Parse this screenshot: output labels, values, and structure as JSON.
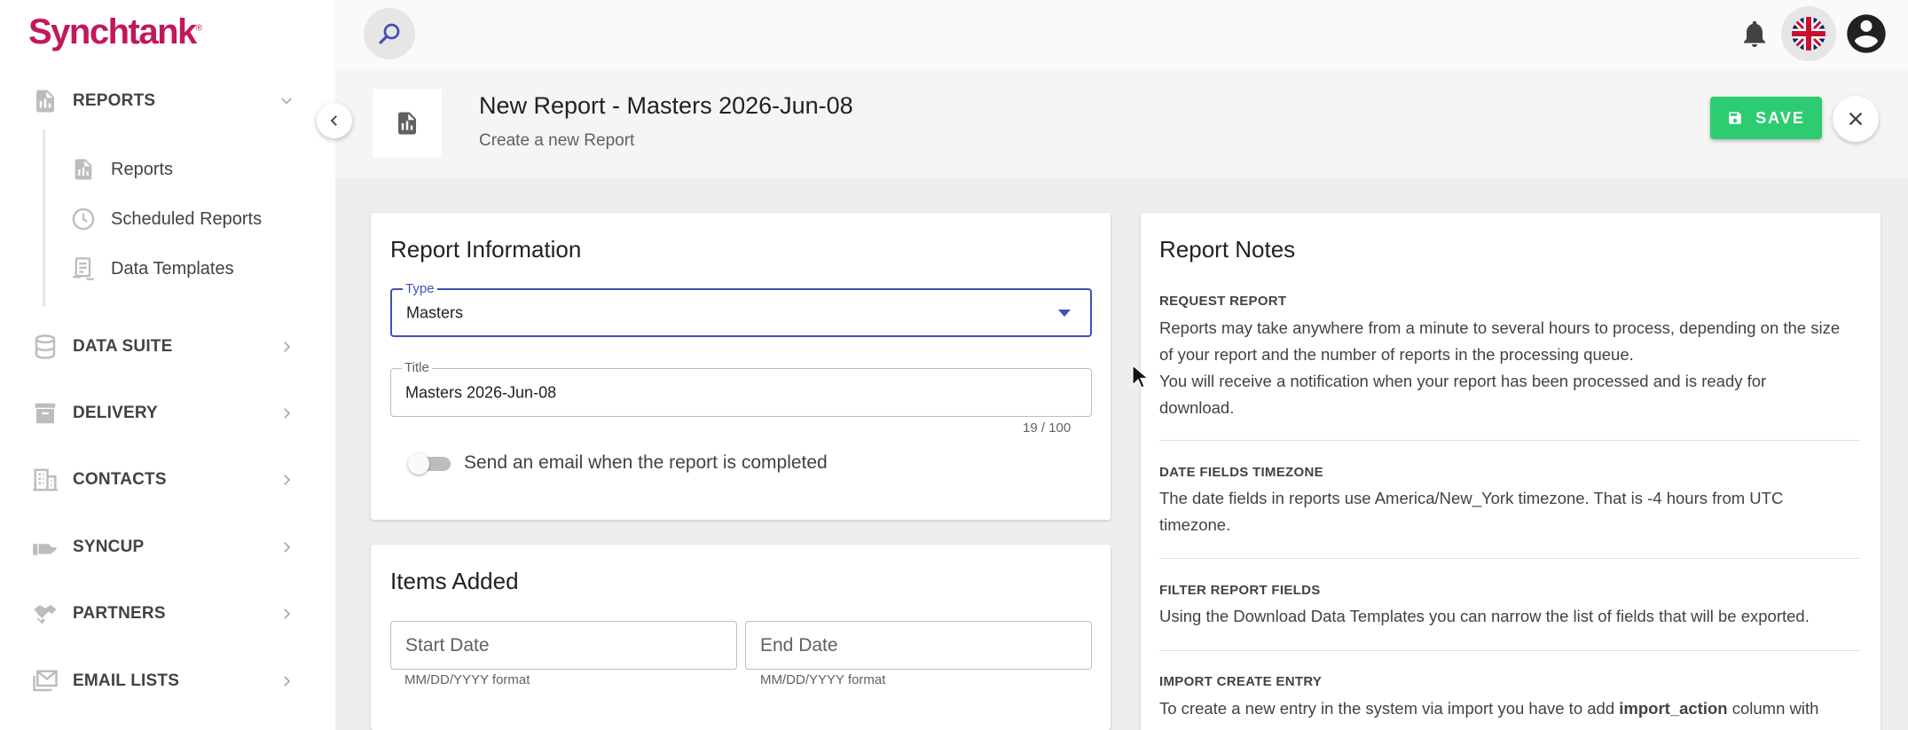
{
  "brand": {
    "logo_text": "Synchtank",
    "logo_mark": "®",
    "color": "#c2185b"
  },
  "sidebar": {
    "groups": [
      {
        "label": "REPORTS",
        "icon": "report-file-icon",
        "expanded": true
      },
      {
        "label": "DATA SUITE",
        "icon": "database-icon"
      },
      {
        "label": "DELIVERY",
        "icon": "archive-box-icon"
      },
      {
        "label": "CONTACTS",
        "icon": "building-icon"
      },
      {
        "label": "SYNCUP",
        "icon": "hand-icon"
      },
      {
        "label": "PARTNERS",
        "icon": "handshake-icon"
      },
      {
        "label": "EMAIL LISTS",
        "icon": "mail-list-icon"
      }
    ],
    "report_items": [
      {
        "label": "Reports",
        "icon": "report-file-icon"
      },
      {
        "label": "Scheduled Reports",
        "icon": "clock-icon"
      },
      {
        "label": "Data Templates",
        "icon": "template-icon"
      }
    ]
  },
  "header": {
    "title": "New Report - Masters 2026-Jun-08",
    "subtitle": "Create a new Report",
    "save_label": "SAVE",
    "save_color": "#2ecc71"
  },
  "report_info": {
    "heading": "Report Information",
    "type_label": "Type",
    "type_value": "Masters",
    "title_label": "Title",
    "title_value": "Masters 2026-Jun-08",
    "char_count": "19 / 100",
    "email_toggle_label": "Send an email when the report is completed",
    "email_toggle_on": false
  },
  "items_added": {
    "heading": "Items Added",
    "start_placeholder": "Start Date",
    "start_hint": "MM/DD/YYYY format",
    "end_placeholder": "End Date",
    "end_hint": "MM/DD/YYYY format"
  },
  "notes": {
    "heading": "Report Notes",
    "sections": [
      {
        "title": "REQUEST REPORT",
        "lines": [
          "Reports may take anywhere from a minute to several hours to process, depending on the size",
          "of your report and the number of reports in the processing queue.",
          "You will receive a notification when your report has been processed and is ready for",
          "download."
        ]
      },
      {
        "title": "DATE FIELDS TIMEZONE",
        "lines": [
          "The date fields in reports use America/New_York timezone. That is -4 hours from UTC",
          "timezone."
        ]
      },
      {
        "title": "FILTER REPORT FIELDS",
        "lines": [
          "Using the Download Data Templates you can narrow the list of fields that will be exported."
        ]
      },
      {
        "title": "IMPORT CREATE ENTRY",
        "line_prefix": "To create a new entry in the system via import you have to add ",
        "line_bold": "import_action",
        "line_suffix": " column with"
      }
    ]
  },
  "accent_color": "#3f51b5"
}
